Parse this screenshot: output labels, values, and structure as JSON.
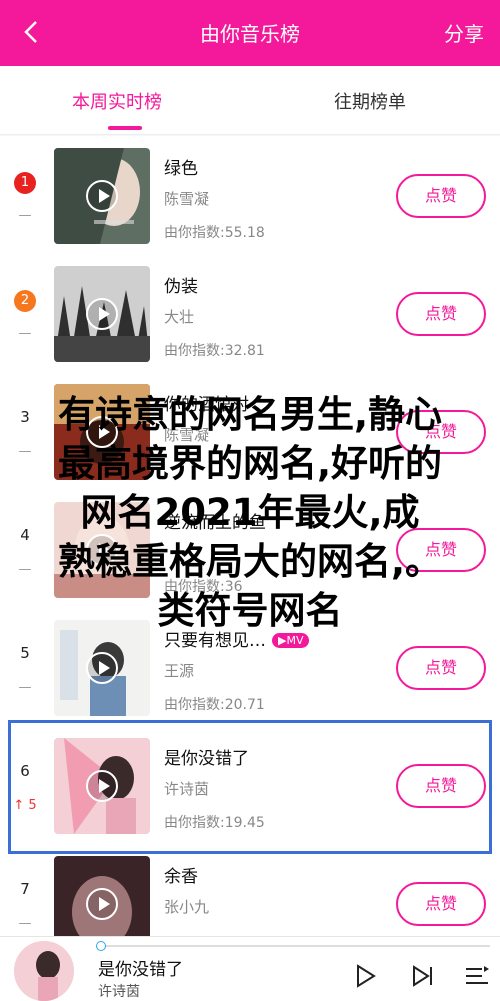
{
  "header": {
    "title": "由你音乐榜",
    "share_label": "分享"
  },
  "tabs": [
    {
      "label": "本周实时榜"
    },
    {
      "label": "往期榜单"
    }
  ],
  "songs": [
    {
      "rank": "1",
      "change": "—",
      "title": "绿色",
      "artist": "陈雪凝",
      "index": "由你指数:55.18",
      "like": "点赞"
    },
    {
      "rank": "2",
      "change": "—",
      "title": "伪装",
      "artist": "大壮",
      "index": "由你指数:32.81",
      "like": "点赞"
    },
    {
      "rank": "3",
      "change": "—",
      "title": "你的酒馆对",
      "artist": "陈雪凝",
      "index": "",
      "like": "点赞"
    },
    {
      "rank": "4",
      "change": "—",
      "title": "逆流而上的鱼",
      "artist": "",
      "index": "由你指数:36",
      "like": "点赞"
    },
    {
      "rank": "5",
      "change": "—",
      "title": "只要有想见…",
      "mv": "MV",
      "artist": "王源",
      "index": "由你指数:20.71",
      "like": "点赞"
    },
    {
      "rank": "6",
      "change": "↑ 5",
      "title": "是你没错了",
      "artist": "许诗茵",
      "index": "由你指数:19.45",
      "like": "点赞"
    },
    {
      "rank": "7",
      "change": "—",
      "title": "余香",
      "artist": "张小九",
      "index": "",
      "like": "点赞"
    }
  ],
  "overlay_text": {
    "line1": "有诗意的网名男生,静心",
    "line2": "最高境界的网名,好听的",
    "line3": "网名2021年最火,成",
    "line4": "熟稳重格局大的网名,。",
    "line5": "类符号网名"
  },
  "player": {
    "title": "是你没错了",
    "artist": "许诗茵"
  },
  "colors": {
    "accent": "#f3199a",
    "rank1": "#e8221f",
    "rank2": "#f5781f",
    "highlight_border": "#3b6fd6"
  },
  "icons": [
    "back-arrow-icon",
    "play-icon",
    "next-icon",
    "playlist-icon"
  ]
}
